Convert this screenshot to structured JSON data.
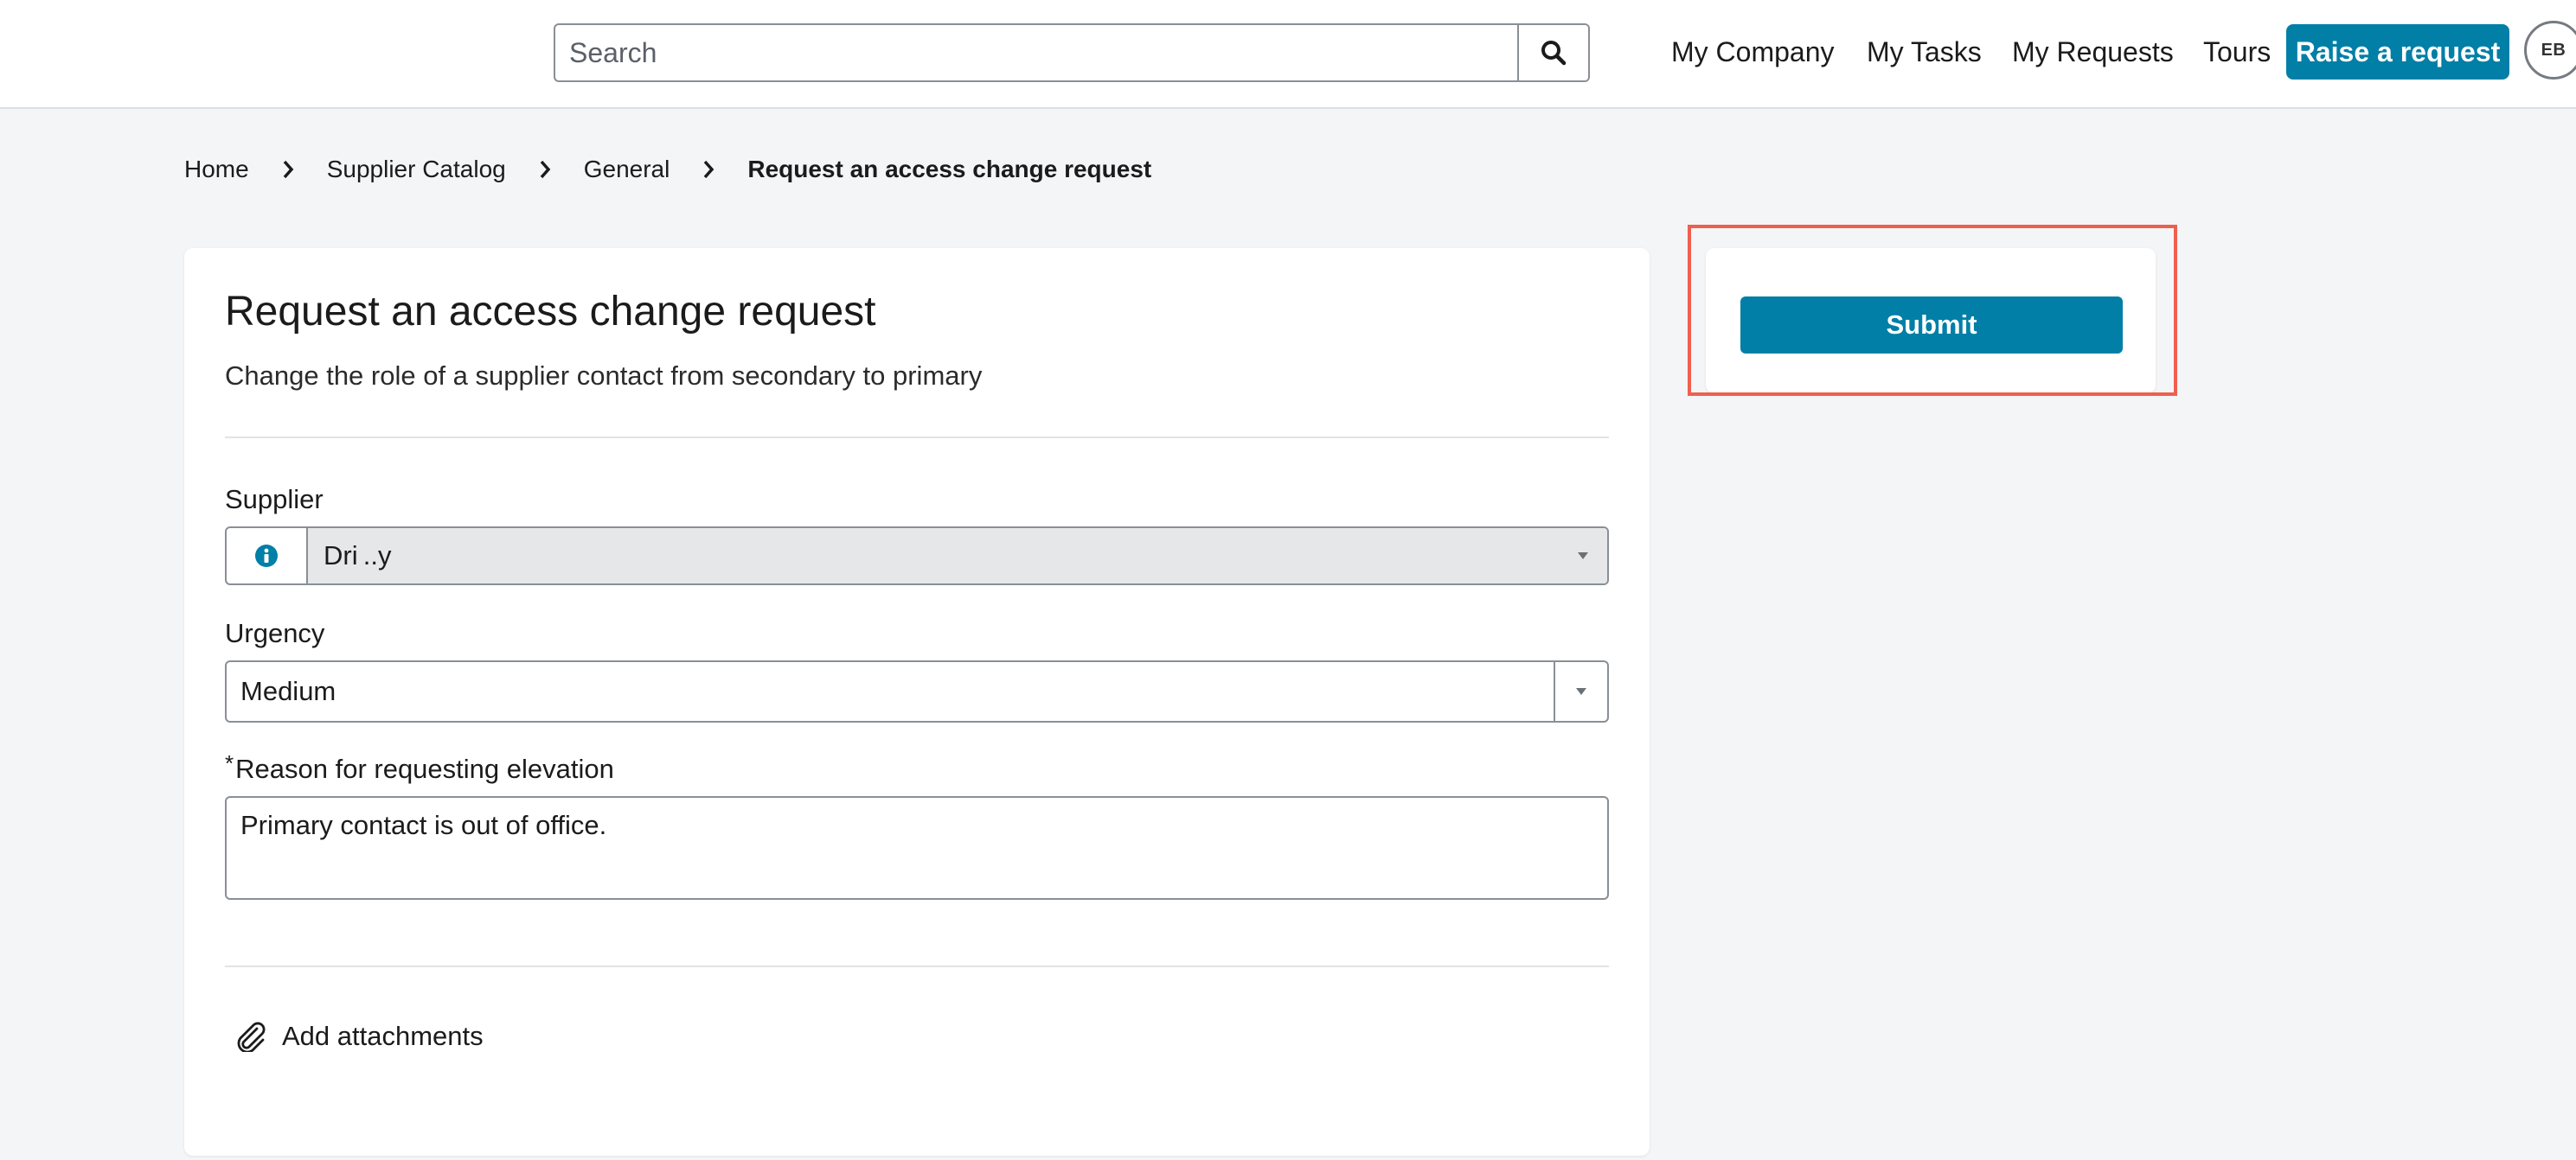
{
  "header": {
    "search_placeholder": "Search",
    "nav": [
      "My Company",
      "My Tasks",
      "My Requests",
      "Tours"
    ],
    "raise_label": "Raise a request",
    "avatar_initials": "EB",
    "accent_color": "#017fa6"
  },
  "breadcrumb": [
    "Home",
    "Supplier Catalog",
    "General",
    "Request an access change request"
  ],
  "form": {
    "title": "Request an access change request",
    "subtitle": "Change the role of a supplier contact from secondary to primary",
    "supplier_label": "Supplier",
    "supplier_value": "Dri ..y",
    "urgency_label": "Urgency",
    "urgency_value": "Medium",
    "reason_required_mark": "*",
    "reason_label": "Reason for requesting elevation",
    "reason_value": "Primary contact is out of office.",
    "attach_label": "Add attachments"
  },
  "actions": {
    "submit_label": "Submit"
  },
  "icons": {
    "search": "search-icon",
    "breadcrumb_separator": "chevron-right-icon",
    "supplier_info": "info-icon",
    "dropdown": "caret-down-icon",
    "attach": "paperclip-icon"
  },
  "highlight_color": "#ef5f4e"
}
